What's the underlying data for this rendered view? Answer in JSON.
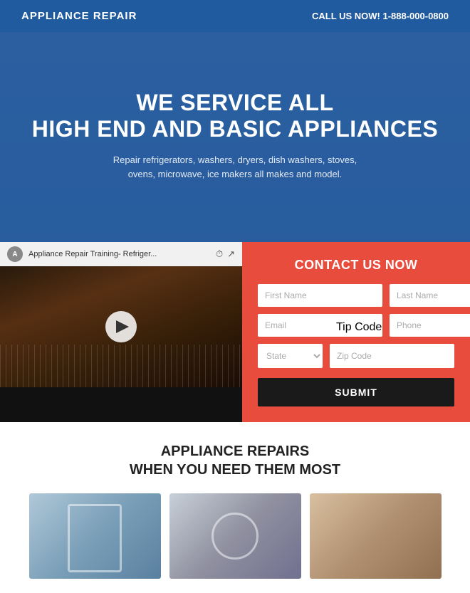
{
  "header": {
    "logo": "APPLIANCE REPAIR",
    "cta_prefix": "CALL US NOW!",
    "phone": "1-888-000-0800"
  },
  "hero": {
    "title_line1": "WE SERVICE ALL",
    "title_line2": "HIGH END AND BASIC APPLIANCES",
    "subtitle": "Repair refrigerators, washers, dryers, dish washers, stoves, ovens, microwave, ice makers all makes and model."
  },
  "video": {
    "title": "Appliance Repair Training- Refriger...",
    "watch_label": "Watch later",
    "share_label": "Share"
  },
  "form": {
    "title": "CONTACT US NOW",
    "first_name_placeholder": "First Name",
    "last_name_placeholder": "Last Name",
    "email_placeholder": "Email",
    "phone_placeholder": "Phone",
    "state_placeholder": "State",
    "zip_placeholder": "Zip Code",
    "submit_label": "SUBMIT"
  },
  "lower": {
    "title_line1": "APPLIANCE REPAIRS",
    "title_line2": "WHEN YOU NEED THEM MOST"
  },
  "tip_code": {
    "label": "Tip Code"
  },
  "colors": {
    "hero_bg": "#2563a8",
    "form_bg": "#e84c3d",
    "submit_bg": "#1a1a1a",
    "text_dark": "#222222",
    "text_white": "#ffffff"
  }
}
